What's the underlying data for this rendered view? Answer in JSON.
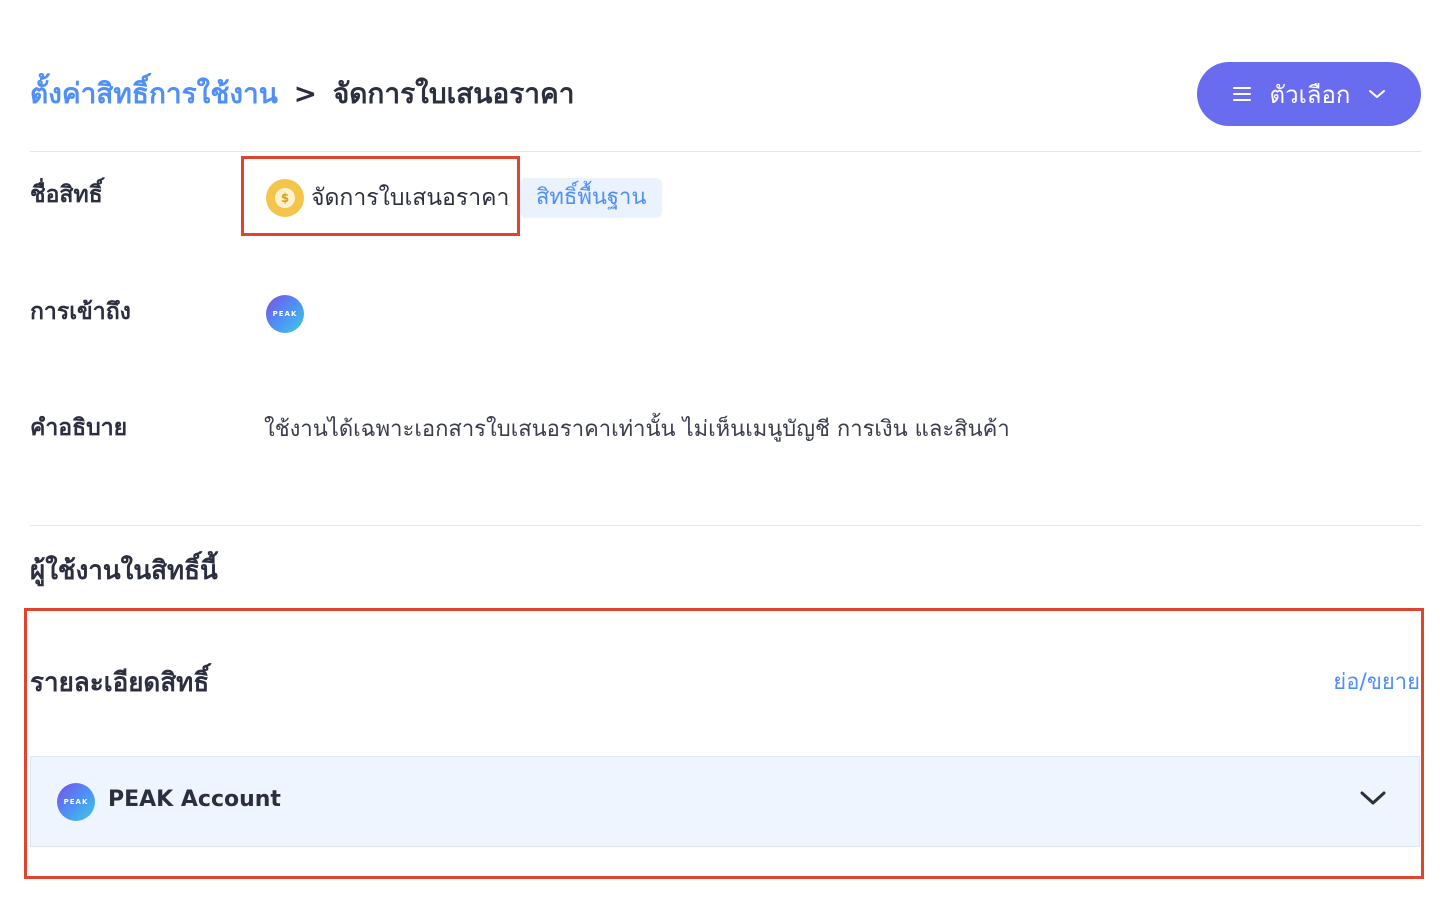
{
  "header": {
    "breadcrumb_link": "ตั้งค่าสิทธิ์การใช้งาน",
    "breadcrumb_separator": ">",
    "breadcrumb_current": "จัดการใบเสนอราคา",
    "options_button": "ตัวเลือก"
  },
  "details": {
    "name_label": "ชื่อสิทธิ์",
    "permission_name": "จัดการใบเสนอราคา",
    "permission_icon": "coin-icon",
    "badge": "สิทธิ์พื้นฐาน",
    "access_label": "การเข้าถึง",
    "access_logo_text": "PEAK",
    "description_label": "คำอธิบาย",
    "description": "ใช้งานได้เฉพาะเอกสารใบเสนอราคาเท่านั้น ไม่เห็นเมนูบัญชี การเงิน และสินค้า"
  },
  "users_section": {
    "title": "ผู้ใช้งานในสิทธิ์นี้"
  },
  "permission_details": {
    "title": "รายละเอียดสิทธิ์",
    "toggle_link": "ย่อ/ขยาย",
    "apps": [
      {
        "logo_text": "PEAK",
        "name": "PEAK Account"
      }
    ]
  },
  "colors": {
    "accent": "#6a6cf0",
    "link": "#4f8ff7",
    "highlight_border": "#e0432e",
    "badge_bg": "#eaf2fd",
    "row_bg": "#eef5fe"
  }
}
